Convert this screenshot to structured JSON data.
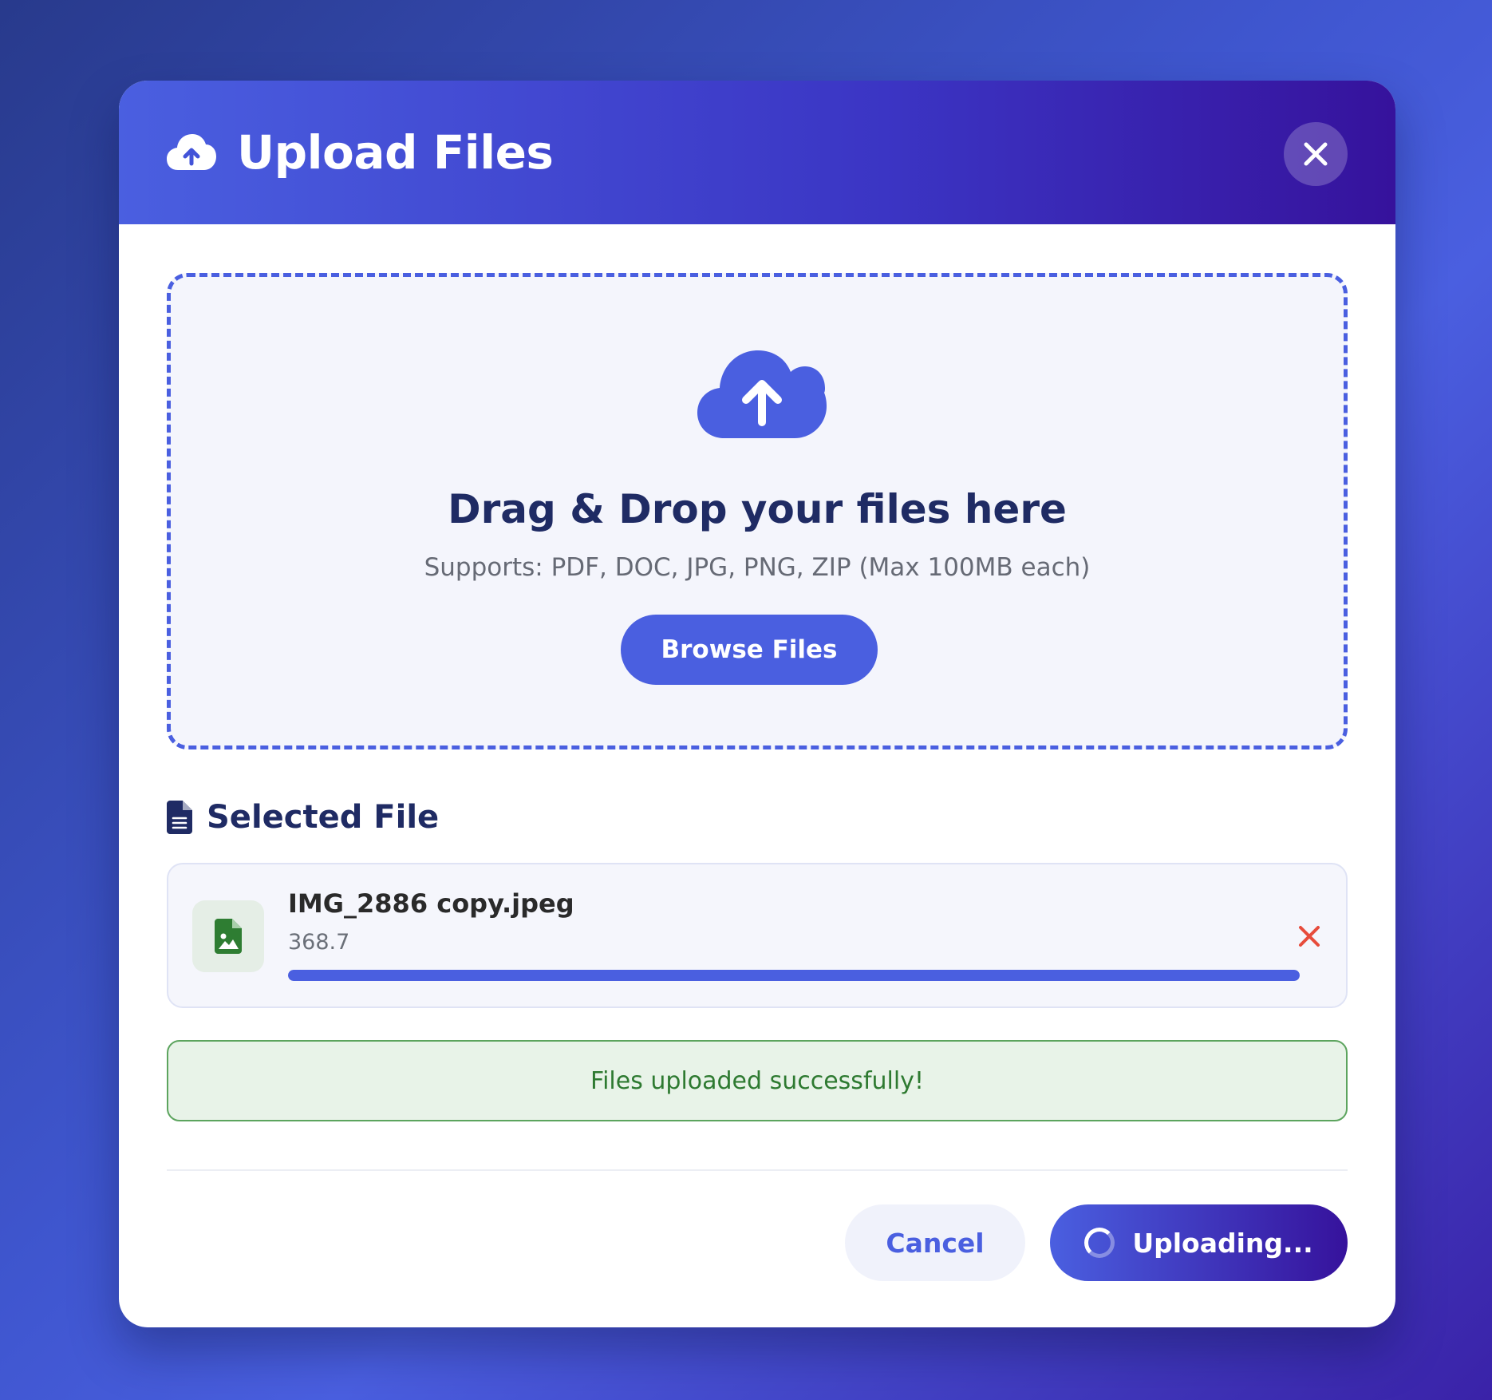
{
  "header": {
    "icon": "cloud-upload-icon",
    "title": "Upload Files",
    "close_icon": "close-icon"
  },
  "dropzone": {
    "icon": "cloud-upload-icon",
    "title": "Drag & Drop your files here",
    "subtitle": "Supports: PDF, DOC, JPG, PNG, ZIP (Max 100MB each)",
    "browse_label": "Browse Files"
  },
  "selected": {
    "icon": "document-icon",
    "title": "Selected File",
    "files": [
      {
        "icon": "image-file-icon",
        "name": "IMG_2886 copy.jpeg",
        "size": "368.7",
        "progress": 1.0,
        "remove_icon": "remove-icon"
      }
    ]
  },
  "status": {
    "message": "Files uploaded successfully!"
  },
  "footer": {
    "cancel_label": "Cancel",
    "upload_label": "Uploading..."
  },
  "colors": {
    "accent": "#4a5fe0",
    "accent_dark": "#36129c",
    "heading": "#1f2b64",
    "success_bg": "#e8f3e8",
    "success_text": "#2e7a31",
    "danger": "#e74c3c",
    "file_icon": "#2e7d32"
  }
}
